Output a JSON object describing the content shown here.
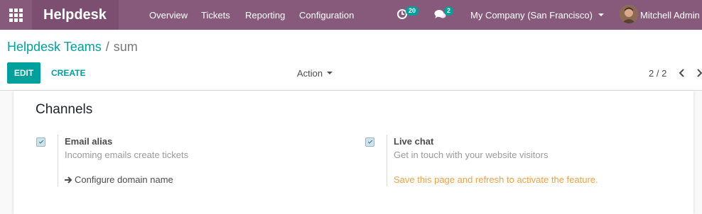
{
  "navbar": {
    "brand": "Helpdesk",
    "menu": [
      "Overview",
      "Tickets",
      "Reporting",
      "Configuration"
    ],
    "activity_count": "20",
    "message_count": "2",
    "company": "My Company (San Francisco)",
    "user": "Mitchell Admin",
    "accent_color": "#875a7b"
  },
  "breadcrumb": {
    "parent": "Helpdesk Teams",
    "separator": "/",
    "current": "sum"
  },
  "buttons": {
    "edit": "EDIT",
    "create": "CREATE",
    "action": "Action"
  },
  "pager": {
    "value": "2 / 2"
  },
  "channels": {
    "title": "Channels",
    "email": {
      "checked": true,
      "label": "Email alias",
      "help": "Incoming emails create tickets",
      "link": "Configure domain name"
    },
    "livechat": {
      "checked": true,
      "label": "Live chat",
      "help": "Get in touch with your website visitors",
      "warning": "Save this page and refresh to activate the feature."
    }
  }
}
